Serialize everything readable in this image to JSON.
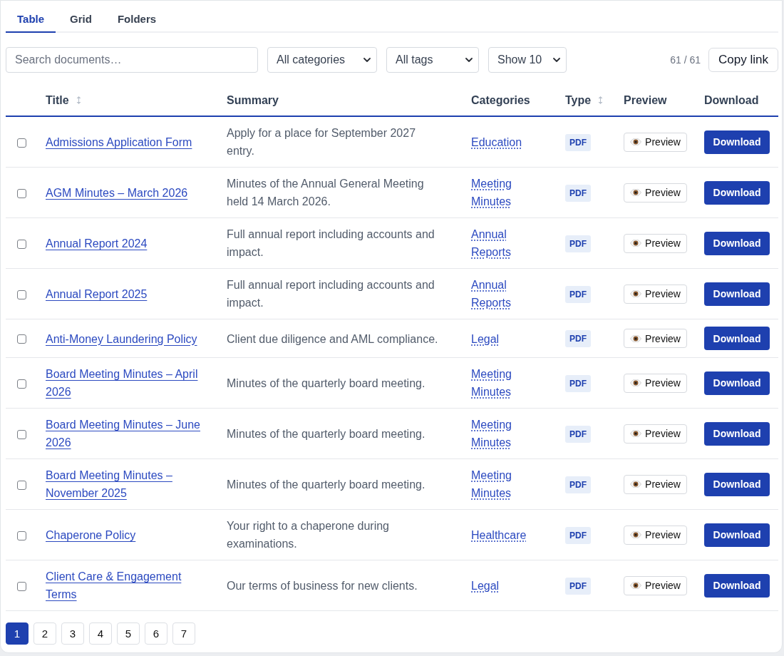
{
  "tabs": [
    {
      "label": "Table",
      "selected": true
    },
    {
      "label": "Grid",
      "selected": false
    },
    {
      "label": "Folders",
      "selected": false
    }
  ],
  "toolbar": {
    "search": {
      "placeholder": "Search documents…"
    },
    "filters": [
      {
        "value": "All categories"
      },
      {
        "value": "All tags"
      },
      {
        "value": "Show 10"
      }
    ],
    "count": "61 / 61",
    "copy_button": "Copy link"
  },
  "table": {
    "columns": [
      {
        "label": "Title",
        "sortable": true
      },
      {
        "label": "Summary",
        "sortable": false
      },
      {
        "label": "Categories",
        "sortable": false
      },
      {
        "label": "Type",
        "sortable": true
      },
      {
        "label": "Preview",
        "sortable": false
      },
      {
        "label": "Download",
        "sortable": false
      }
    ],
    "rows": [
      {
        "checked": false,
        "title": "Admissions Application Form",
        "summary": "Apply for a place for September 2027 entry.",
        "category": "Education",
        "type": "PDF",
        "preview": "Preview",
        "download": "Download"
      },
      {
        "checked": false,
        "title": "AGM Minutes – March 2026",
        "summary": "Minutes of the Annual General Meeting held 14 March 2026.",
        "category": "Meeting Minutes",
        "type": "PDF",
        "preview": "Preview",
        "download": "Download"
      },
      {
        "checked": false,
        "title": "Annual Report 2024",
        "summary": "Full annual report including accounts and impact.",
        "category": "Annual Reports",
        "type": "PDF",
        "preview": "Preview",
        "download": "Download"
      },
      {
        "checked": false,
        "title": "Annual Report 2025",
        "summary": "Full annual report including accounts and impact.",
        "category": "Annual Reports",
        "type": "PDF",
        "preview": "Preview",
        "download": "Download"
      },
      {
        "checked": false,
        "title": "Anti-Money Laundering Policy",
        "summary": "Client due diligence and AML compliance.",
        "category": "Legal",
        "type": "PDF",
        "preview": "Preview",
        "download": "Download"
      },
      {
        "checked": false,
        "title": "Board Meeting Minutes – April 2026",
        "summary": "Minutes of the quarterly board meeting.",
        "category": "Meeting Minutes",
        "type": "PDF",
        "preview": "Preview",
        "download": "Download"
      },
      {
        "checked": false,
        "title": "Board Meeting Minutes – June 2026",
        "summary": "Minutes of the quarterly board meeting.",
        "category": "Meeting Minutes",
        "type": "PDF",
        "preview": "Preview",
        "download": "Download"
      },
      {
        "checked": false,
        "title": "Board Meeting Minutes – November 2025",
        "summary": "Minutes of the quarterly board meeting.",
        "category": "Meeting Minutes",
        "type": "PDF",
        "preview": "Preview",
        "download": "Download"
      },
      {
        "checked": false,
        "title": "Chaperone Policy",
        "summary": "Your right to a chaperone during examinations.",
        "category": "Healthcare",
        "type": "PDF",
        "preview": "Preview",
        "download": "Download"
      },
      {
        "checked": false,
        "title": "Client Care & Engagement Terms",
        "summary": "Our terms of business for new clients.",
        "category": "Legal",
        "type": "PDF",
        "preview": "Preview",
        "download": "Download"
      }
    ]
  },
  "pagination": [
    {
      "label": "1",
      "selected": true
    },
    {
      "label": "2",
      "selected": false
    },
    {
      "label": "3",
      "selected": false
    },
    {
      "label": "4",
      "selected": false
    },
    {
      "label": "5",
      "selected": false
    },
    {
      "label": "6",
      "selected": false
    },
    {
      "label": "7",
      "selected": false
    }
  ]
}
